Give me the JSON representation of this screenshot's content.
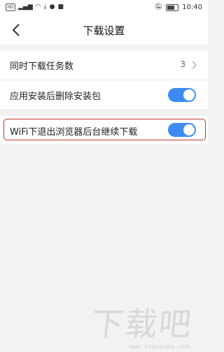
{
  "status_bar": {
    "left_icons": [
      "hd-icon",
      "signal-icon",
      "wifi-icon",
      "download-icon",
      "app-icon",
      "app-icon-2"
    ],
    "time": "10:40",
    "right_icons": [
      "mute-icon",
      "battery-icon"
    ]
  },
  "header": {
    "title": "下载设置",
    "back_icon": "chevron-left-icon"
  },
  "settings": {
    "concurrent": {
      "label": "同时下载任务数",
      "value": "3"
    },
    "delete_pkg": {
      "label": "应用安装后删除安装包",
      "toggle_on": true
    },
    "wifi_continue": {
      "label": "WiFi下退出浏览器后台继续下载",
      "toggle_on": true
    }
  },
  "colors": {
    "toggle_on": "#3d8bf2",
    "highlight_border": "#c0392b",
    "background": "#f2f2f2"
  }
}
